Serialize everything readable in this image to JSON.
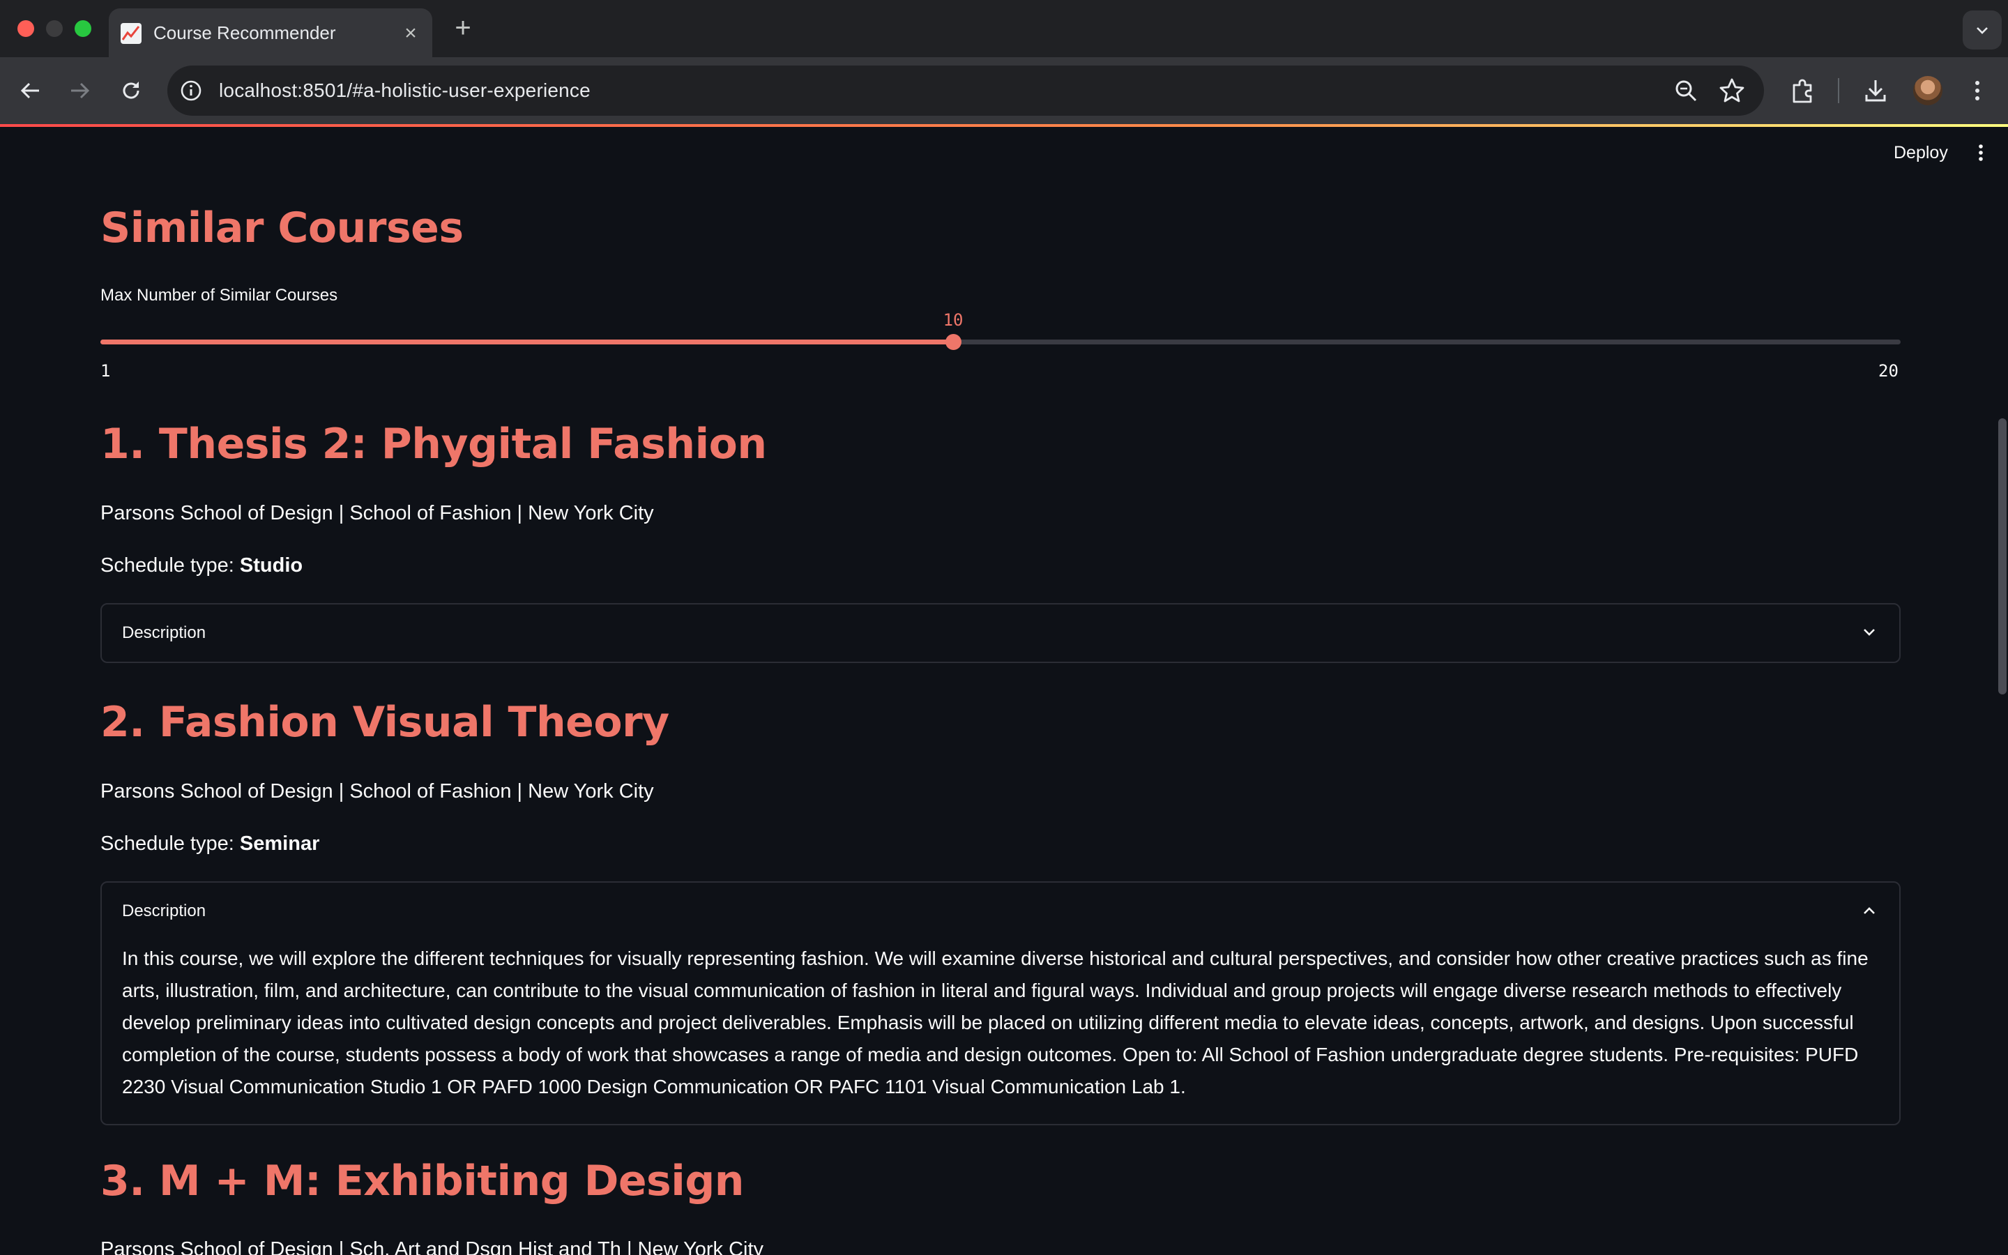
{
  "browser": {
    "tab_title": "Course Recommender",
    "url": "localhost:8501/#a-holistic-user-experience"
  },
  "app": {
    "deploy_label": "Deploy",
    "section_title": "Similar Courses",
    "slider": {
      "label": "Max Number of Similar Courses",
      "value": "10",
      "min": "1",
      "max": "20",
      "fraction": 0.4737
    },
    "courses": [
      {
        "title": "1. Thesis 2: Phygital Fashion",
        "meta": "Parsons School of Design | School of Fashion | New York City",
        "schedule_prefix": "Schedule type: ",
        "schedule_value": "Studio",
        "expander_label": "Description",
        "expanded": false
      },
      {
        "title": "2. Fashion Visual Theory",
        "meta": "Parsons School of Design | School of Fashion | New York City",
        "schedule_prefix": "Schedule type: ",
        "schedule_value": "Seminar",
        "expander_label": "Description",
        "expanded": true,
        "description": "In this course, we will explore the different techniques for visually representing fashion. We will examine diverse historical and cultural perspectives, and consider how other creative practices such as fine arts, illustration, film, and architecture, can contribute to the visual communication of fashion in literal and figural ways. Individual and group projects will engage diverse research methods to effectively develop preliminary ideas into cultivated design concepts and project deliverables. Emphasis will be placed on utilizing different media to elevate ideas, concepts, artwork, and designs. Upon successful completion of the course, students possess a body of work that showcases a range of media and design outcomes. Open to: All School of Fashion undergraduate degree students. Pre-requisites: PUFD 2230 Visual Communication Studio 1 OR PAFD 1000 Design Communication OR PAFC 1101 Visual Communication Lab 1."
      },
      {
        "title": "3. M + M: Exhibiting Design",
        "meta": "Parsons School of Design | Sch. Art and Dsgn Hist and Th | New York City"
      }
    ]
  },
  "colors": {
    "accent": "#ef7669",
    "background": "#0e1117",
    "text": "#fafafa"
  },
  "icons": [
    "chart-favicon-icon",
    "close-icon",
    "plus-icon",
    "back-icon",
    "forward-icon",
    "reload-icon",
    "site-info-icon",
    "zoom-icon",
    "bookmark-star-icon",
    "extensions-icon",
    "download-icon",
    "more-vert-icon",
    "chevron-down-icon",
    "chevron-up-icon"
  ]
}
